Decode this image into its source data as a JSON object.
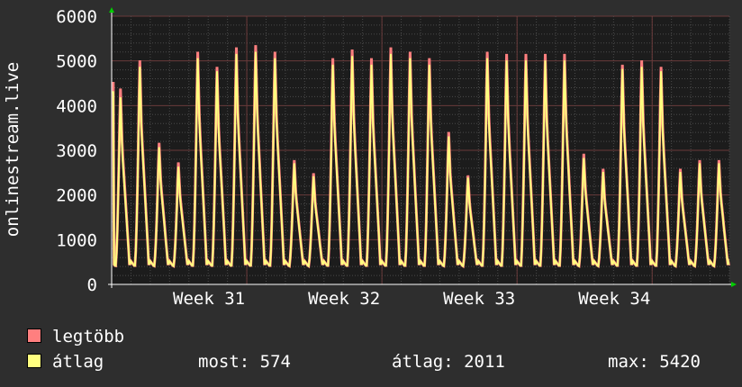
{
  "chart_data": {
    "type": "area",
    "ylabel": "onlinestream.live",
    "ylim": [
      0,
      6000
    ],
    "y_ticks": [
      0,
      1000,
      2000,
      3000,
      4000,
      5000,
      6000
    ],
    "x_ticks": [
      "Week 31",
      "Week 32",
      "Week 33",
      "Week 34"
    ],
    "grid": true,
    "daily_peaks_max": [
      4500,
      5150,
      3250,
      2800,
      5350,
      5000,
      5450,
      5500,
      5350,
      2850,
      2550,
      5200,
      5400,
      5200,
      5450,
      5350,
      5200,
      3500,
      2500,
      5350,
      5300,
      5300,
      5300,
      5300,
      3000,
      2650,
      5050,
      5150,
      5000,
      2650,
      2850,
      2850
    ],
    "daily_peaks_avg": [
      4300,
      5000,
      3150,
      2700,
      5200,
      4900,
      5300,
      5350,
      5200,
      2780,
      2480,
      5050,
      5250,
      5050,
      5300,
      5200,
      5050,
      3400,
      2450,
      5200,
      5150,
      5150,
      5150,
      5150,
      2900,
      2580,
      4950,
      5000,
      4900,
      2580,
      2780,
      2780
    ],
    "trough": 400,
    "series": [
      {
        "name": "legtöbb",
        "color": "#ff7f7f"
      },
      {
        "name": "átlag",
        "color": "#ffff7f"
      }
    ]
  },
  "legend": {
    "max_label": "legtöbb",
    "avg_label": "átlag"
  },
  "stats": {
    "now": "most: 574",
    "avg": "átlag: 2011",
    "max": "max: 5420"
  },
  "colors": {
    "bg": "#2e2e2e",
    "plot_bg": "#1c1c1c",
    "grid": "#5a5a5a",
    "max": "#ff7f7f",
    "avg": "#ffff7f",
    "arrow": "#00cc00"
  }
}
